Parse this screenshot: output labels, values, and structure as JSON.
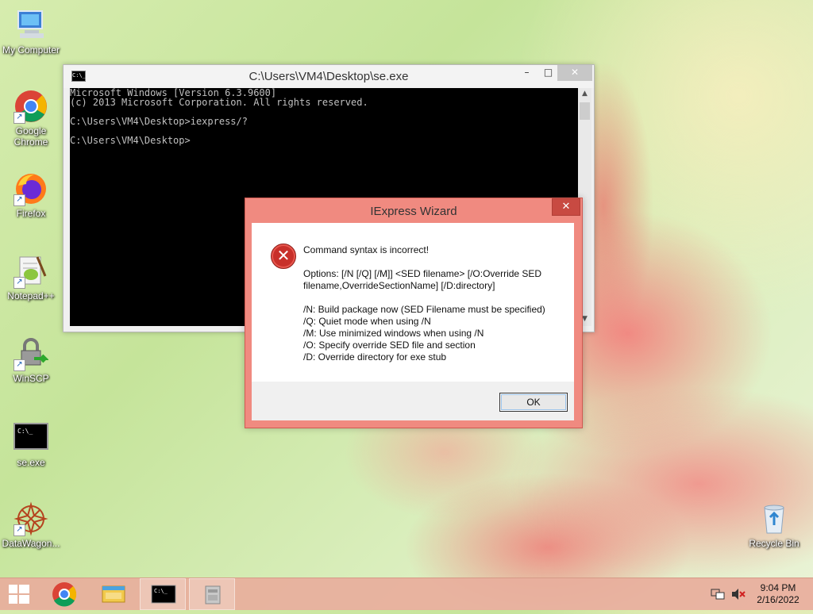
{
  "desktop": {
    "icons": [
      {
        "label": "My Computer"
      },
      {
        "label": "Google Chrome"
      },
      {
        "label": "Firefox"
      },
      {
        "label": "Notepad++"
      },
      {
        "label": "WinSCP"
      },
      {
        "label": "se.exe"
      },
      {
        "label": "DataWagon..."
      },
      {
        "label": "Recycle Bin"
      }
    ]
  },
  "console_window": {
    "title": "C:\\Users\\VM4\\Desktop\\se.exe",
    "icon_text": "C:\\_",
    "controls": {
      "minimize": "–",
      "maximize": "□",
      "close": "✕"
    },
    "text": "Microsoft Windows [Version 6.3.9600]\n(c) 2013 Microsoft Corporation. All rights reserved.\n\nC:\\Users\\VM4\\Desktop>iexpress/?\n\nC:\\Users\\VM4\\Desktop>"
  },
  "dialog": {
    "title": "IExpress Wizard",
    "close": "✕",
    "icon": "error-icon",
    "heading": "Command syntax is incorrect!",
    "options": "Options: [/N [/Q] [/M]] <SED filename> [/O:Override SED filename,OverrideSectionName] [/D:directory]",
    "lines": [
      "/N: Build package now (SED Filename must be specified)",
      "/Q: Quiet mode when using /N",
      "/M: Use minimized windows when using /N",
      "/O: Specify override SED file and section",
      "/D: Override directory for exe stub"
    ],
    "ok_label": "OK"
  },
  "taskbar": {
    "items": [
      "start-button",
      "chrome-icon",
      "file-explorer-icon",
      "console-icon",
      "iexpress-icon"
    ],
    "time": "9:04 PM",
    "date": "2/16/2022"
  },
  "colors": {
    "dialog_accent": "#f08a80",
    "taskbar": "#e8ae9c"
  }
}
